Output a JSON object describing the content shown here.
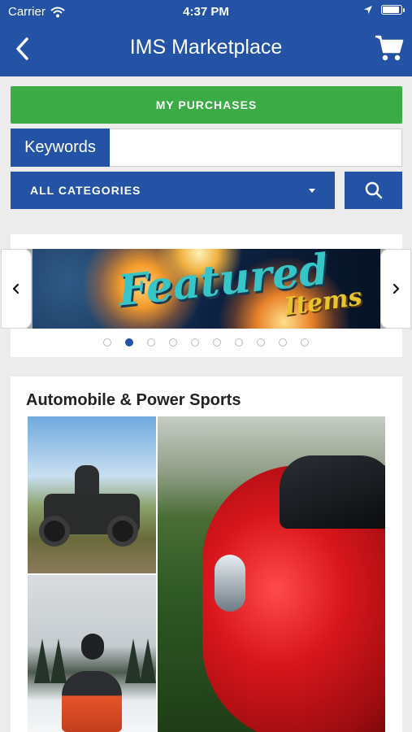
{
  "status": {
    "carrier": "Carrier",
    "time": "4:37 PM"
  },
  "nav": {
    "title": "IMS Marketplace"
  },
  "purchases": {
    "label": "MY PURCHASES"
  },
  "search": {
    "keywords_label": "Keywords",
    "keywords_value": "",
    "category": "ALL CATEGORIES"
  },
  "featured": {
    "title": "Featured",
    "subtitle": "Items",
    "slide_count": 10,
    "active_slide": 2
  },
  "categories": [
    {
      "title": "Automobile & Power Sports"
    }
  ],
  "colors": {
    "primary": "#2453a6",
    "success": "#3bab46",
    "background": "#ececec"
  }
}
